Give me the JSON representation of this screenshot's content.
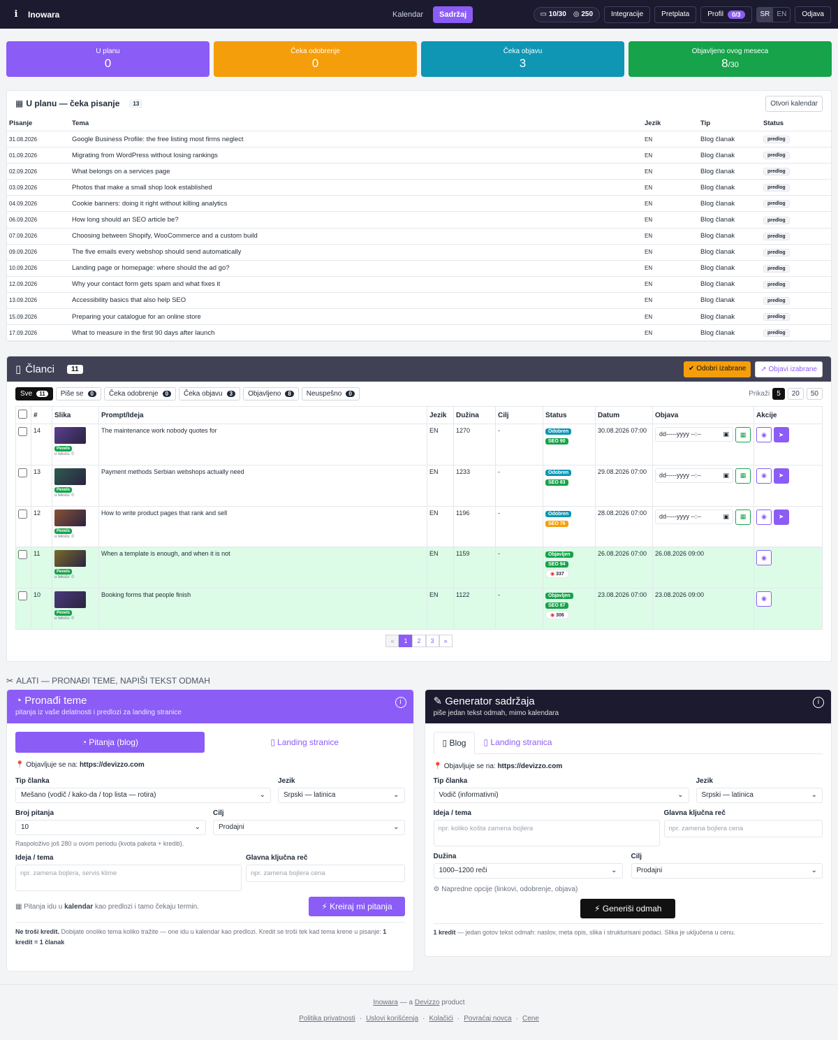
{
  "app": {
    "name": "Inowara"
  },
  "nav": {
    "calendar": "Kalendar",
    "content": "Sadržaj",
    "quota": "10/30",
    "credits": "250",
    "integrations": "Integracije",
    "subscription": "Pretplata",
    "profile": "Profil",
    "profile_badge": "0/3",
    "lang_sr": "SR",
    "lang_en": "EN",
    "logout": "Odjava"
  },
  "stats": [
    {
      "label": "U planu",
      "value": "0",
      "color": "#8b5cf6"
    },
    {
      "label": "Čeka odobrenje",
      "value": "0",
      "color": "#f59e0b"
    },
    {
      "label": "Čeka objavu",
      "value": "3",
      "color": "#0e96b4"
    },
    {
      "label": "Objavljeno ovog meseca",
      "value": "8",
      "suffix": "/30",
      "color": "#16a34a"
    }
  ],
  "plan": {
    "title": "U planu — čeka pisanje",
    "count": "13",
    "open_calendar": "Otvori kalendar",
    "headers": [
      "Pisanje",
      "Tema",
      "Jezik",
      "Tip",
      "Status"
    ],
    "rows": [
      [
        "31.08.2026",
        "Google Business Profile: the free listing most firms neglect",
        "EN",
        "Blog članak",
        "predlog"
      ],
      [
        "01.09.2026",
        "Migrating from WordPress without losing rankings",
        "EN",
        "Blog članak",
        "predlog"
      ],
      [
        "02.09.2026",
        "What belongs on a services page",
        "EN",
        "Blog članak",
        "predlog"
      ],
      [
        "03.09.2026",
        "Photos that make a small shop look established",
        "EN",
        "Blog članak",
        "predlog"
      ],
      [
        "04.09.2026",
        "Cookie banners: doing it right without killing analytics",
        "EN",
        "Blog članak",
        "predlog"
      ],
      [
        "06.09.2026",
        "How long should an SEO article be?",
        "EN",
        "Blog članak",
        "predlog"
      ],
      [
        "07.09.2026",
        "Choosing between Shopify, WooCommerce and a custom build",
        "EN",
        "Blog članak",
        "predlog"
      ],
      [
        "09.09.2026",
        "The five emails every webshop should send automatically",
        "EN",
        "Blog članak",
        "predlog"
      ],
      [
        "10.09.2026",
        "Landing page or homepage: where should the ad go?",
        "EN",
        "Blog članak",
        "predlog"
      ],
      [
        "12.09.2026",
        "Why your contact form gets spam and what fixes it",
        "EN",
        "Blog članak",
        "predlog"
      ],
      [
        "13.09.2026",
        "Accessibility basics that also help SEO",
        "EN",
        "Blog članak",
        "predlog"
      ],
      [
        "15.09.2026",
        "Preparing your catalogue for an online store",
        "EN",
        "Blog članak",
        "predlog"
      ],
      [
        "17.09.2026",
        "What to measure in the first 90 days after launch",
        "EN",
        "Blog članak",
        "predlog"
      ]
    ]
  },
  "articles": {
    "title": "Članci",
    "count": "11",
    "approve_selected": "Odobri izabrane",
    "publish_selected": "Objavi izabrane",
    "filters": [
      {
        "label": "Sve",
        "count": "11"
      },
      {
        "label": "Piše se",
        "count": "0"
      },
      {
        "label": "Čeka odobrenje",
        "count": "0"
      },
      {
        "label": "Čeka objavu",
        "count": "3"
      },
      {
        "label": "Objavljeno",
        "count": "8"
      },
      {
        "label": "Neuspešno",
        "count": "0"
      }
    ],
    "show_label": "Prikaži",
    "per_page": [
      "5",
      "20",
      "50"
    ],
    "headers": [
      "#",
      "Slika",
      "Prompt/Ideja",
      "Jezik",
      "Dužina",
      "Cilj",
      "Status",
      "Datum",
      "Objava",
      "Akcije"
    ],
    "date_placeholder": "dd-----yyyy --:--",
    "rows": [
      {
        "id": "14",
        "thumb": "#5b3f8f",
        "src": "Pexels",
        "uses": "u tekstu: 0",
        "prompt": "The maintenance work nobody quotes for",
        "lang": "EN",
        "len": "1270",
        "goal": "-",
        "status": "Odobren",
        "status_color": "#0e96b4",
        "seo": "SEO 90",
        "seo_color": "#16a34a",
        "date": "30.08.2026 07:00",
        "pub": "",
        "views": ""
      },
      {
        "id": "13",
        "thumb": "#2f5a4f",
        "src": "Pexels",
        "uses": "u tekstu: 0",
        "prompt": "Payment methods Serbian webshops actually need",
        "lang": "EN",
        "len": "1233",
        "goal": "-",
        "status": "Odobren",
        "status_color": "#0e96b4",
        "seo": "SEO 83",
        "seo_color": "#16a34a",
        "date": "29.08.2026 07:00",
        "pub": "",
        "views": ""
      },
      {
        "id": "12",
        "thumb": "#8a5234",
        "src": "Pexels",
        "uses": "u tekstu: 0",
        "prompt": "How to write product pages that rank and sell",
        "lang": "EN",
        "len": "1196",
        "goal": "-",
        "status": "Odobren",
        "status_color": "#0e96b4",
        "seo": "SEO 76",
        "seo_color": "#f59e0b",
        "date": "28.08.2026 07:00",
        "pub": "",
        "views": ""
      },
      {
        "id": "11",
        "thumb": "#7a6a2a",
        "src": "Pexels",
        "uses": "u tekstu: 0",
        "prompt": "When a template is enough, and when it is not",
        "lang": "EN",
        "len": "1159",
        "goal": "-",
        "status": "Objavljen",
        "status_color": "#16a34a",
        "seo": "SEO 94",
        "seo_color": "#16a34a",
        "date": "26.08.2026 07:00",
        "pub": "26.08.2026 09:00",
        "views": "337"
      },
      {
        "id": "10",
        "thumb": "#4b3a7a",
        "src": "Pexels",
        "uses": "u tekstu: 0",
        "prompt": "Booking forms that people finish",
        "lang": "EN",
        "len": "1122",
        "goal": "-",
        "status": "Objavljen",
        "status_color": "#16a34a",
        "seo": "SEO 87",
        "seo_color": "#16a34a",
        "date": "23.08.2026 07:00",
        "pub": "23.08.2026 09:00",
        "views": "306"
      }
    ],
    "pages": [
      "«",
      "1",
      "2",
      "3",
      "»"
    ]
  },
  "tools": {
    "heading": "ALATI — PRONAĐI TEME, NAPIŠI TEKST ODMAH",
    "finder": {
      "title": "Pronađi teme",
      "subtitle": "pitanja iz vaše delatnosti i predlozi za landing stranice",
      "tab_blog": "Pitanja (blog)",
      "tab_landing": "Landing stranice",
      "publish_on_label": "Objavljuje se na:",
      "publish_on": "https://devizzo.com",
      "type_label": "Tip članka",
      "type_value": "Mešano (vodič / kako-da / top lista — rotira)",
      "lang_label": "Jezik",
      "lang_value": "Srpski — latinica",
      "count_label": "Broj pitanja",
      "count_value": "10",
      "goal_label": "Cilj",
      "goal_value": "Prodajni",
      "remaining": "Raspoloživo još 280 u ovom periodu (kvota paketa + krediti).",
      "idea_label": "Ideja / tema",
      "idea_placeholder": "npr. zamena bojlera, servis klime",
      "kw_label": "Glavna ključna reč",
      "kw_placeholder": "npr. zamena bojlera cena",
      "info_pre": "Pitanja idu u ",
      "info_bold": "kalendar",
      "info_post": " kao predlozi i tamo čekaju termin.",
      "create": "Kreiraj mi pitanja",
      "foot_bold": "Ne troši kredit.",
      "foot_text": " Dobijate onoliko tema koliko tražite — one idu u kalendar kao predlozi. Kredit se troši tek kad tema krene u pisanje: ",
      "foot_bold2": "1 kredit = 1 članak"
    },
    "generator": {
      "title": "Generator sadržaja",
      "subtitle": "piše jedan tekst odmah, mimo kalendara",
      "tab_blog": "Blog",
      "tab_landing": "Landing stranica",
      "publish_on_label": "Objavljuje se na:",
      "publish_on": "https://devizzo.com",
      "type_label": "Tip članka",
      "type_value": "Vodič (informativni)",
      "lang_label": "Jezik",
      "lang_value": "Srpski — latinica",
      "idea_label": "Ideja / tema",
      "idea_placeholder": "npr. koliko košta zamena bojlera",
      "kw_label": "Glavna ključna reč",
      "kw_placeholder": "npr. zamena bojlera cena",
      "len_label": "Dužina",
      "len_value": "1000–1200 reči",
      "goal_label": "Cilj",
      "goal_value": "Prodajni",
      "advanced": "Napredne opcije (linkovi, odobrenje, objava)",
      "generate": "Generiši odmah",
      "foot_bold": "1 kredit",
      "foot_text": " — jedan gotov tekst odmah: naslov, meta opis, slika i strukturisani podaci. Slika je uključena u cenu."
    }
  },
  "footer": {
    "brand": "Inowara",
    "mid": " — a ",
    "company": "Devizzo",
    "product": " product",
    "links": [
      "Politika privatnosti",
      "Uslovi korišćenja",
      "Kolačići",
      "Povraćaj novca",
      "Cene"
    ]
  }
}
